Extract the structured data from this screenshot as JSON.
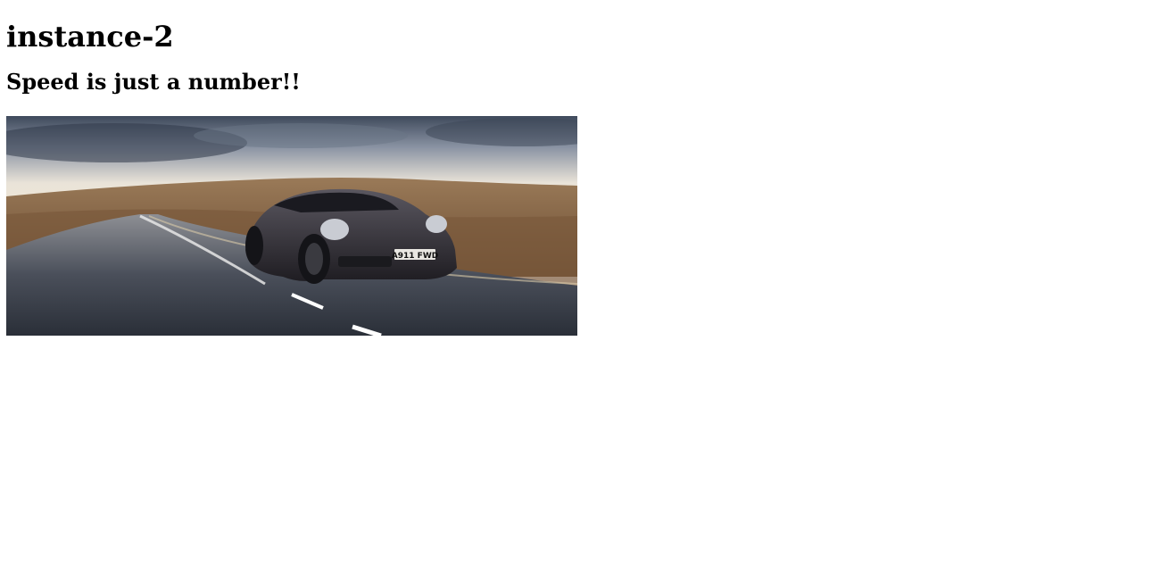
{
  "page": {
    "heading": "instance-2",
    "subheading": "Speed is just a number!!"
  },
  "hero_image": {
    "plate_text": "A911 FWD",
    "colors": {
      "sky_top": "#3f4a5c",
      "sky_bottom": "#e9e3d8",
      "hills": "#8a6a48",
      "road": "#3a3f4a",
      "car_body": "#2e2c33"
    }
  }
}
